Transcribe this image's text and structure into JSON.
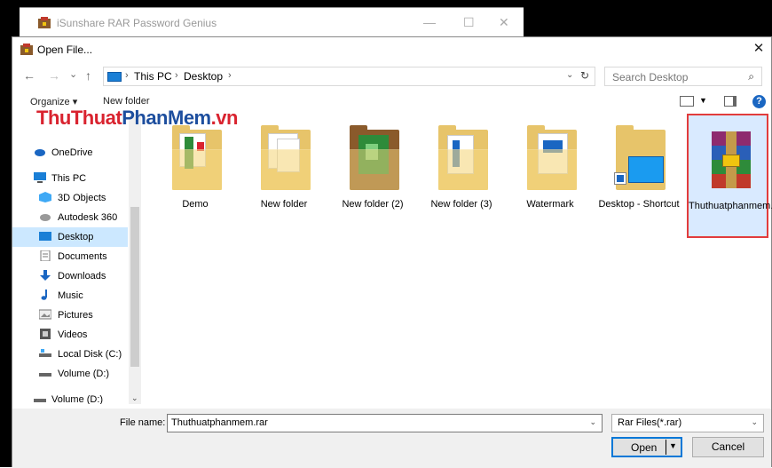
{
  "background_window": {
    "title": "iSunshare RAR Password Genius",
    "controls": [
      "—",
      "☐",
      "✕"
    ]
  },
  "dialog": {
    "title": "Open File...",
    "close_glyph": "✕"
  },
  "navigation": {
    "back": "←",
    "forward": "→",
    "recent": "⌄",
    "up": "↑",
    "breadcrumb": [
      "This PC",
      "Desktop"
    ],
    "separator": "›",
    "refresh": "↻",
    "dropdown": "⌄"
  },
  "search": {
    "placeholder": "Search Desktop",
    "icon": "⌕"
  },
  "toolbar": {
    "organize_label": "Organize ▾",
    "new_folder_label": "New folder",
    "help_label": "?"
  },
  "watermark": {
    "part1": "ThuThuat",
    "part2": "PhanMem",
    "part3": ".vn"
  },
  "sidebar": {
    "items": [
      {
        "label": "OneDrive",
        "icon": "cloud-icon",
        "color": "#1a66c2"
      },
      {
        "label": "This PC",
        "icon": "computer-icon",
        "color": "#1a7fd6"
      },
      {
        "label": "3D Objects",
        "icon": "cube-icon",
        "color": "#3fa9f5"
      },
      {
        "label": "Autodesk 360",
        "icon": "cloud-drive-icon",
        "color": "#888888"
      },
      {
        "label": "Desktop",
        "icon": "desktop-icon",
        "color": "#1a7fd6"
      },
      {
        "label": "Documents",
        "icon": "document-icon",
        "color": "#999999"
      },
      {
        "label": "Downloads",
        "icon": "download-arrow-icon",
        "color": "#1a66c2"
      },
      {
        "label": "Music",
        "icon": "music-note-icon",
        "color": "#1a66c2"
      },
      {
        "label": "Pictures",
        "icon": "picture-icon",
        "color": "#888888"
      },
      {
        "label": "Videos",
        "icon": "video-icon",
        "color": "#555555"
      },
      {
        "label": "Local Disk (C:)",
        "icon": "drive-icon",
        "color": "#555555"
      },
      {
        "label": "Volume (D:)",
        "icon": "drive-icon",
        "color": "#555555"
      },
      {
        "label": "Volume (D:)",
        "icon": "drive-icon",
        "color": "#555555"
      }
    ],
    "selected_label": "Desktop"
  },
  "files": [
    {
      "name": "Demo",
      "icon": "folder-icon"
    },
    {
      "name": "New folder",
      "icon": "folder-icon"
    },
    {
      "name": "New folder (2)",
      "icon": "folder-icon"
    },
    {
      "name": "New folder (3)",
      "icon": "folder-icon"
    },
    {
      "name": "Watermark",
      "icon": "folder-icon"
    },
    {
      "name": "Desktop - Shortcut",
      "icon": "shortcut-folder-icon"
    },
    {
      "name": "Thuthuatphanmem.rar",
      "icon": "winrar-archive-icon",
      "selected": true
    }
  ],
  "bottom": {
    "file_name_label": "File name:",
    "file_name_value": "Thuthuatphanmem.rar",
    "file_type_value": "Rar Files(*.rar)",
    "open_label": "Open",
    "cancel_label": "Cancel",
    "dropdown_glyph": "⌄"
  },
  "colors": {
    "selection": "#cce8ff",
    "accent": "#0078d7",
    "highlight_border": "#e23c3c"
  }
}
